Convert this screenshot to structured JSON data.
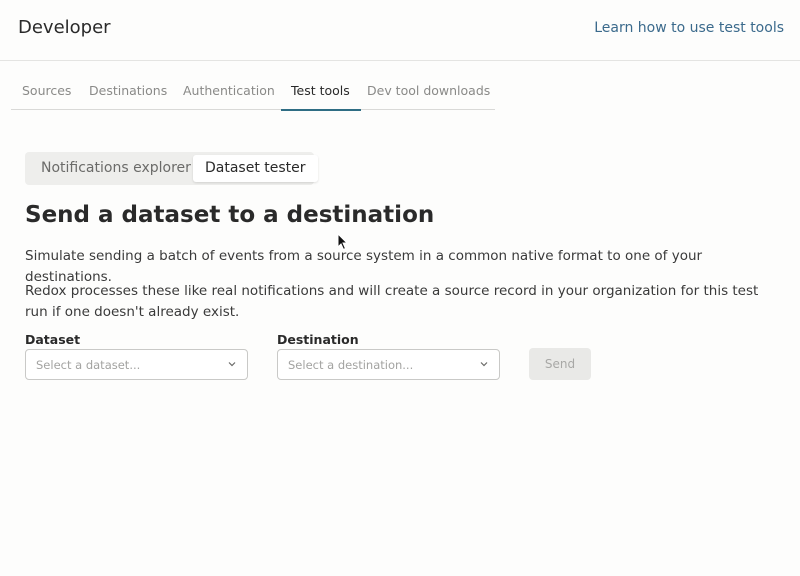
{
  "header": {
    "title": "Developer",
    "help_link": "Learn how to use test tools"
  },
  "nav_tabs": [
    {
      "label": "Sources"
    },
    {
      "label": "Destinations"
    },
    {
      "label": "Authentication"
    },
    {
      "label": "Test tools",
      "active": true
    },
    {
      "label": "Dev tool downloads"
    }
  ],
  "segments": [
    {
      "label": "Notifications explorer"
    },
    {
      "label": "Dataset tester",
      "active": true
    }
  ],
  "main": {
    "heading": "Send a dataset to a destination",
    "description_1": "Simulate sending a batch of events from a source system in a common native format to one of your destinations.",
    "description_2": "Redox processes these like real notifications and will create a source record in your organization for this test run if one doesn't already exist."
  },
  "form": {
    "dataset_label": "Dataset",
    "dataset_placeholder": "Select a dataset...",
    "destination_label": "Destination",
    "destination_placeholder": "Select a destination...",
    "send_label": "Send"
  },
  "colors": {
    "accent": "#2f6d84",
    "link": "#3b6a8c"
  }
}
